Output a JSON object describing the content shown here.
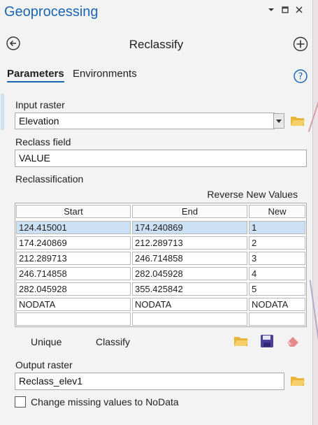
{
  "pane": {
    "title": "Geoprocessing",
    "window_controls": {
      "dropdown_icon": "chevron-down-icon",
      "maximize_icon": "maximize-icon",
      "close_icon": "close-icon"
    }
  },
  "tool": {
    "title": "Reclassify",
    "back_icon": "back-arrow-icon",
    "add_icon": "add-circle-icon"
  },
  "tabs": [
    {
      "label": "Parameters",
      "active": true
    },
    {
      "label": "Environments",
      "active": false
    }
  ],
  "help_icon": "help-icon",
  "input_raster": {
    "label": "Input raster",
    "value": "Elevation",
    "browse_icon": "folder-icon"
  },
  "reclass_field": {
    "label": "Reclass field",
    "value": "VALUE"
  },
  "reclassification": {
    "label": "Reclassification",
    "reverse_label": "Reverse New Values",
    "columns": [
      "Start",
      "End",
      "New"
    ],
    "rows": [
      [
        "124.415001",
        "174.240869",
        "1"
      ],
      [
        "174.240869",
        "212.289713",
        "2"
      ],
      [
        "212.289713",
        "246.714858",
        "3"
      ],
      [
        "246.714858",
        "282.045928",
        "4"
      ],
      [
        "282.045928",
        "355.425842",
        "5"
      ],
      [
        "NODATA",
        "NODATA",
        "NODATA"
      ],
      [
        "",
        "",
        ""
      ]
    ],
    "selected_row": 0,
    "unique_label": "Unique",
    "classify_label": "Classify",
    "toolbar_icons": [
      "folder-open-icon",
      "save-icon",
      "eraser-icon"
    ]
  },
  "output_raster": {
    "label": "Output raster",
    "value": "Reclass_elev1",
    "browse_icon": "folder-icon"
  },
  "nodata_option": {
    "label": "Change missing values to NoData",
    "checked": false
  },
  "colors": {
    "accent": "#1a66b3",
    "selection": "#cce0f4",
    "folder": "#e8b536",
    "save": "#4a3f9a",
    "eraser": "#e58a8a"
  }
}
